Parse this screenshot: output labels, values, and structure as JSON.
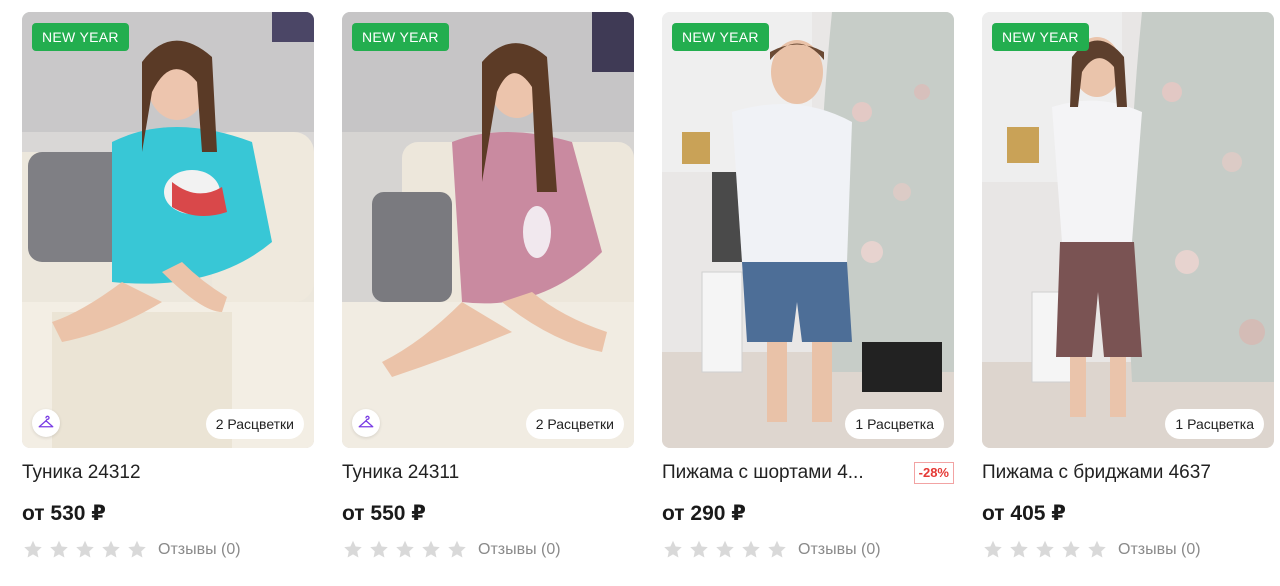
{
  "products": [
    {
      "badge": "NEW YEAR",
      "colors_label": "2 Расцветки",
      "has_size_icon": true,
      "title": "Туника 24312",
      "discount": "",
      "price": "от 530 ₽",
      "reviews": "Отзывы (0)",
      "rating": 0
    },
    {
      "badge": "NEW YEAR",
      "colors_label": "2 Расцветки",
      "has_size_icon": true,
      "title": "Туника 24311",
      "discount": "",
      "price": "от 550 ₽",
      "reviews": "Отзывы (0)",
      "rating": 0
    },
    {
      "badge": "NEW YEAR",
      "colors_label": "1 Расцветка",
      "has_size_icon": false,
      "title": "Пижама с шортами 4...",
      "discount": "-28%",
      "price": "от 290 ₽",
      "reviews": "Отзывы (0)",
      "rating": 0
    },
    {
      "badge": "NEW YEAR",
      "colors_label": "1 Расцветка",
      "has_size_icon": false,
      "title": "Пижама с бриджами 4637",
      "discount": "",
      "price": "от 405 ₽",
      "reviews": "Отзывы (0)",
      "rating": 0
    }
  ],
  "colors": {
    "badge_green": "#23ae4f",
    "discount_red": "#e53935",
    "star_empty": "#d9d9d9",
    "size_icon_purple": "#7b3fe4"
  },
  "icons": {
    "size": "hanger-icon",
    "star": "star-icon"
  }
}
